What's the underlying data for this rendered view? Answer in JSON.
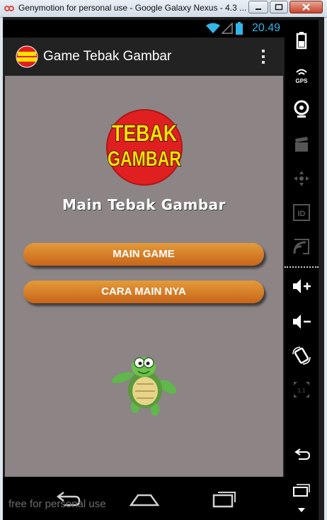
{
  "window": {
    "title": "Genymotion for personal use - Google Galaxy Nexus - 4.3 ...",
    "watermark": "free for personal use"
  },
  "status_bar": {
    "time": "20.49"
  },
  "action_bar": {
    "app_title": "Game Tebak Gambar"
  },
  "main": {
    "logo_line1": "TEBAK",
    "logo_line2": "GAMBAR",
    "heading": "Main Tebak Gambar",
    "buttons": [
      "MAIN GAME",
      "CARA MAIN NYA"
    ]
  },
  "side_toolbar": {
    "gps_label": "GPS",
    "id_label": "ID",
    "scale_label": "1:1"
  },
  "colors": {
    "content_bg": "#8c8485",
    "button_orange": "#d97e2a",
    "accent_blue": "#33b5e5",
    "logo_red": "#e02020",
    "logo_yellow": "#ffe000"
  }
}
